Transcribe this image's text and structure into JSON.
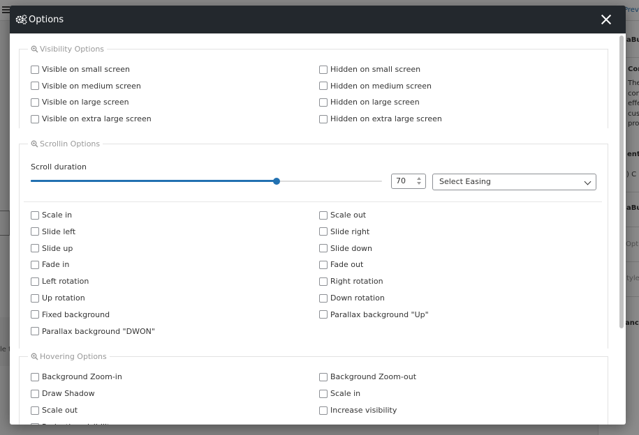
{
  "background": {
    "left_text": "le t",
    "right_items": [
      "Previ",
      "aBui",
      "Cor",
      "The",
      "con",
      "effe",
      "cus",
      "pro",
      "ent E",
      ") C",
      "aBui",
      "Opti",
      "tyle",
      "ance"
    ]
  },
  "modal": {
    "title": "Options",
    "visibility": {
      "legend": "Visibility Options",
      "options": [
        "Visible on small screen",
        "Hidden on small screen",
        "Visible on medium screen",
        "Hidden on medium screen",
        "Visible on large screen",
        "Hidden on large screen",
        "Visible on extra large screen",
        "Hidden on extra large screen"
      ]
    },
    "scrolling": {
      "legend": "Scrollin Options",
      "duration_label": "Scroll duration",
      "duration_value": "70",
      "duration_percent": 70,
      "easing_placeholder": "Select Easing",
      "options": [
        "Scale in",
        "Scale out",
        "Slide left",
        "Slide right",
        "Slide up",
        "Slide down",
        "Fade in",
        "Fade out",
        "Left rotation",
        "Right rotation",
        "Up rotation",
        "Down rotation",
        "Fixed background",
        "Parallax background \"Up\"",
        "Parallax background \"DWON\""
      ]
    },
    "hovering": {
      "legend": "Hovering Options",
      "options": [
        "Background Zoom-in",
        "Background Zoom-out",
        "Draw Shadow",
        "Scale in",
        "Scale out",
        "Increase visibility",
        "Reduction visibility"
      ]
    }
  }
}
